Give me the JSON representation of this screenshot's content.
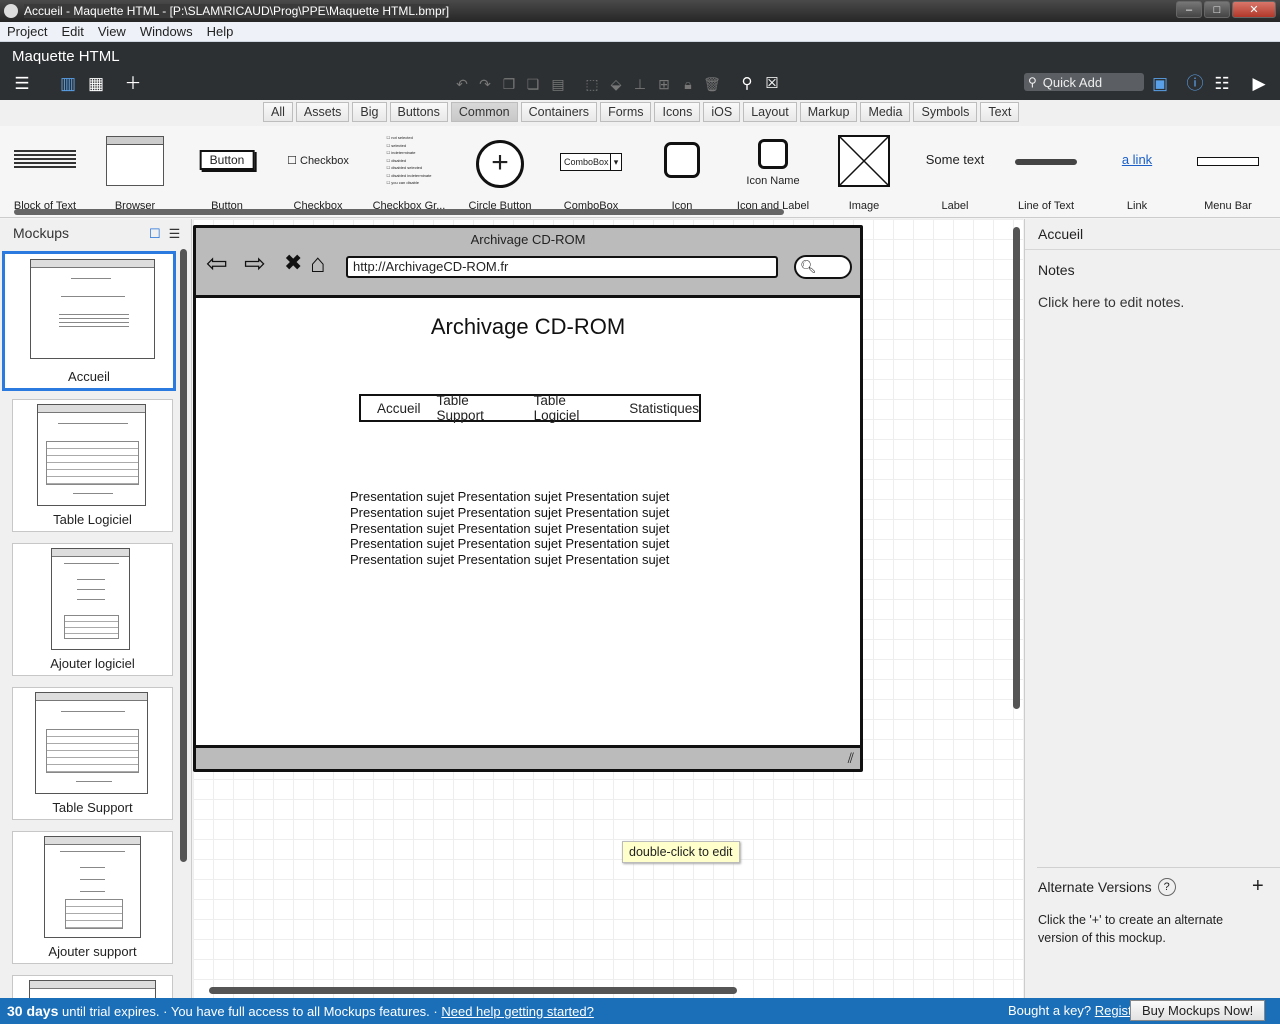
{
  "window": {
    "title": "Accueil - Maquette HTML - [P:\\SLAM\\RICAUD\\Prog\\PPE\\Maquette HTML.bmpr]",
    "controls": {
      "minimize": "–",
      "maximize": "□",
      "close": "✕"
    }
  },
  "menu": [
    "Project",
    "Edit",
    "View",
    "Windows",
    "Help"
  ],
  "app": {
    "name": "Maquette HTML",
    "quick_add_placeholder": "Quick Add"
  },
  "categories": [
    "All",
    "Assets",
    "Big",
    "Buttons",
    "Common",
    "Containers",
    "Forms",
    "Icons",
    "iOS",
    "Layout",
    "Markup",
    "Media",
    "Symbols",
    "Text"
  ],
  "active_category": "Common",
  "library": [
    {
      "label": "Block of Text"
    },
    {
      "label": "Browser"
    },
    {
      "label": "Button",
      "preview": "Button"
    },
    {
      "label": "Checkbox",
      "preview": "Checkbox"
    },
    {
      "label": "Checkbox Gr...",
      "preview_items": [
        "not selected",
        "selected",
        "indeterminate",
        "disabled",
        "disabled selected",
        "disabled indeterminate",
        "you can disable"
      ]
    },
    {
      "label": "Circle Button"
    },
    {
      "label": "ComboBox",
      "preview": "ComboBox"
    },
    {
      "label": "Icon"
    },
    {
      "label": "Icon and Label",
      "preview": "Icon Name"
    },
    {
      "label": "Image"
    },
    {
      "label": "Label",
      "preview": "Some text"
    },
    {
      "label": "Line of Text"
    },
    {
      "label": "Link",
      "preview": "a link"
    },
    {
      "label": "Menu Bar"
    }
  ],
  "mockups_panel": {
    "header": "Mockups",
    "items": [
      {
        "label": "Accueil",
        "selected": true
      },
      {
        "label": "Table Logiciel"
      },
      {
        "label": "Ajouter logiciel"
      },
      {
        "label": "Table Support"
      },
      {
        "label": "Ajouter support"
      }
    ]
  },
  "mockup": {
    "browser_title": "Archivage CD-ROM",
    "url": "http://ArchivageCD-ROM.fr",
    "page_title": "Archivage CD-ROM",
    "nav": [
      "Accueil",
      "Table Support",
      "Table Logiciel",
      "Statistiques"
    ],
    "text_lines": [
      "Presentation sujet Presentation sujet Presentation sujet",
      "Presentation sujet Presentation sujet Presentation sujet",
      "Presentation sujet Presentation sujet Presentation sujet",
      "Presentation sujet Presentation sujet Presentation sujet",
      "Presentation sujet Presentation sujet Presentation sujet"
    ]
  },
  "canvas": {
    "tooltip": "double-click to edit"
  },
  "inspector": {
    "mockup_name": "Accueil",
    "notes_header": "Notes",
    "notes_placeholder": "Click here to edit notes.",
    "alt_header": "Alternate Versions",
    "alt_help": "?",
    "alt_text": "Click the '+' to create an alternate version of this mockup."
  },
  "status": {
    "days": "30 days",
    "expires": " until trial expires.  · You have full access to all Mockups features.  · ",
    "help_link": "Need help getting started?",
    "key_text": "Bought a key? ",
    "register_link": "Register...",
    "buy_button": "Buy Mockups Now!"
  }
}
